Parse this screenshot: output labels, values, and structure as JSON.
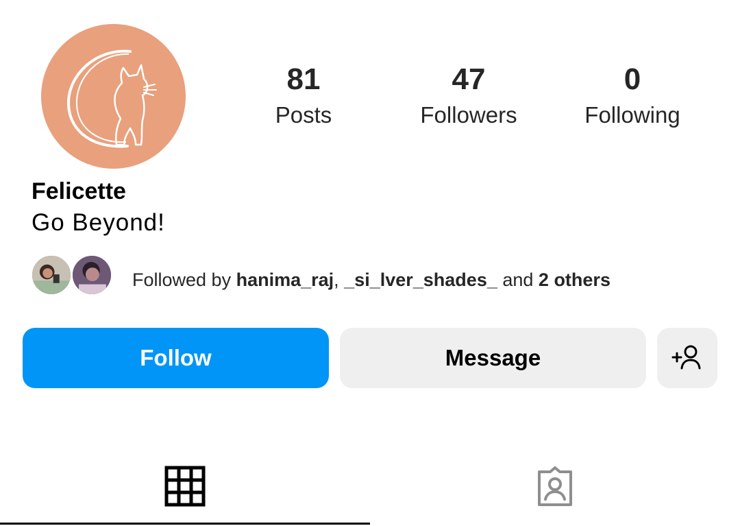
{
  "profile": {
    "name": "Felicette",
    "bio": "Go Beyond!",
    "avatar_color": "#E9A07D",
    "avatar_icon": "cat-moon-logo"
  },
  "stats": {
    "posts": {
      "count": "81",
      "label": "Posts"
    },
    "followers": {
      "count": "47",
      "label": "Followers"
    },
    "following": {
      "count": "0",
      "label": "Following"
    }
  },
  "followed_by": {
    "prefix": "Followed by ",
    "user1": "hanima_raj",
    "separator": ", ",
    "user2": "_si_lver_shades_",
    "conjunction": " and ",
    "others": "2 others"
  },
  "actions": {
    "follow_label": "Follow",
    "message_label": "Message",
    "suggest_icon": "add-person-icon",
    "follow_color": "#0095F6",
    "secondary_color": "#EFEFEF"
  },
  "tabs": [
    {
      "icon": "grid-icon",
      "active": true
    },
    {
      "icon": "tagged-icon",
      "active": false
    }
  ]
}
